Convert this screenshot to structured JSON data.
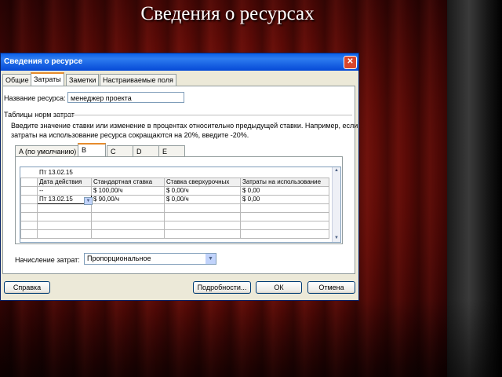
{
  "slide": {
    "title": "Сведения о ресурсах"
  },
  "dialog": {
    "title": "Сведения о ресурсе",
    "tabs": [
      "Общие",
      "Затраты",
      "Заметки",
      "Настраиваемые поля"
    ],
    "resource_name_label": "Название ресурса:",
    "resource_name_value": "менеджер проекта",
    "rates_section_label": "Таблицы норм затрат",
    "instructions_line1": "Введите значение ставки или изменение в процентах относительно предыдущей ставки. Например, если",
    "instructions_line2": "затраты на использование ресурса сокращаются на 20%, введите -20%.",
    "rate_tabs": [
      "A (по умолчанию)",
      "B",
      "C",
      "D",
      "E"
    ],
    "edit_bar_value": "Пт 13.02.15",
    "grid": {
      "headers": [
        "Дата действия",
        "Стандартная ставка",
        "Ставка сверхурочных",
        "Затраты на использование"
      ],
      "rows": [
        [
          "--",
          "$ 100,00/ч",
          "$ 0,00/ч",
          "$ 0,00"
        ],
        [
          "Пт 13.02.15",
          "$ 90,00/ч",
          "$ 0,00/ч",
          "$ 0,00"
        ]
      ]
    },
    "accrual_label": "Начисление затрат:",
    "accrual_value": "Пропорциональное",
    "buttons": {
      "help": "Справка",
      "details": "Подробности...",
      "ok": "ОК",
      "cancel": "Отмена"
    },
    "close_glyph": "✕"
  }
}
